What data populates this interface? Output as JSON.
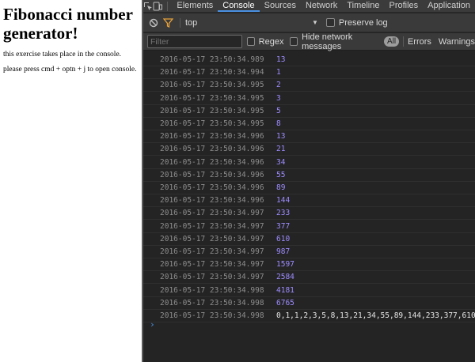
{
  "page": {
    "title": "Fibonacci number generator!",
    "line1": "this exercise takes place in the console.",
    "line2": "please press cmd + optn + j to open console."
  },
  "devtools": {
    "tabs": [
      "Elements",
      "Console",
      "Sources",
      "Network",
      "Timeline",
      "Profiles",
      "Application"
    ],
    "active_tab": "Console",
    "toolbar": {
      "context": "top",
      "preserve_log": "Preserve log"
    },
    "filter": {
      "placeholder": "Filter",
      "regex": "Regex",
      "hide_network": "Hide network messages",
      "all": "All",
      "errors": "Errors",
      "warnings": "Warnings"
    },
    "colors": {
      "accent": "#4a90e2",
      "number": "#9d8cff",
      "timestamp": "#8d8d8d",
      "background": "#242424"
    },
    "rows": [
      {
        "ts": "2016-05-17 23:50:34.989",
        "value": "13"
      },
      {
        "ts": "2016-05-17 23:50:34.994",
        "value": "1"
      },
      {
        "ts": "2016-05-17 23:50:34.995",
        "value": "2"
      },
      {
        "ts": "2016-05-17 23:50:34.995",
        "value": "3"
      },
      {
        "ts": "2016-05-17 23:50:34.995",
        "value": "5"
      },
      {
        "ts": "2016-05-17 23:50:34.995",
        "value": "8"
      },
      {
        "ts": "2016-05-17 23:50:34.996",
        "value": "13"
      },
      {
        "ts": "2016-05-17 23:50:34.996",
        "value": "21"
      },
      {
        "ts": "2016-05-17 23:50:34.996",
        "value": "34"
      },
      {
        "ts": "2016-05-17 23:50:34.996",
        "value": "55"
      },
      {
        "ts": "2016-05-17 23:50:34.996",
        "value": "89"
      },
      {
        "ts": "2016-05-17 23:50:34.996",
        "value": "144"
      },
      {
        "ts": "2016-05-17 23:50:34.997",
        "value": "233"
      },
      {
        "ts": "2016-05-17 23:50:34.997",
        "value": "377"
      },
      {
        "ts": "2016-05-17 23:50:34.997",
        "value": "610"
      },
      {
        "ts": "2016-05-17 23:50:34.997",
        "value": "987"
      },
      {
        "ts": "2016-05-17 23:50:34.997",
        "value": "1597"
      },
      {
        "ts": "2016-05-17 23:50:34.997",
        "value": "2584"
      },
      {
        "ts": "2016-05-17 23:50:34.998",
        "value": "4181"
      },
      {
        "ts": "2016-05-17 23:50:34.998",
        "value": "6765"
      },
      {
        "ts": "2016-05-17 23:50:34.998",
        "value": "0,1,1,2,3,5,8,13,21,34,55,89,144,233,377,610",
        "type": "string"
      }
    ],
    "prompt": "›"
  }
}
